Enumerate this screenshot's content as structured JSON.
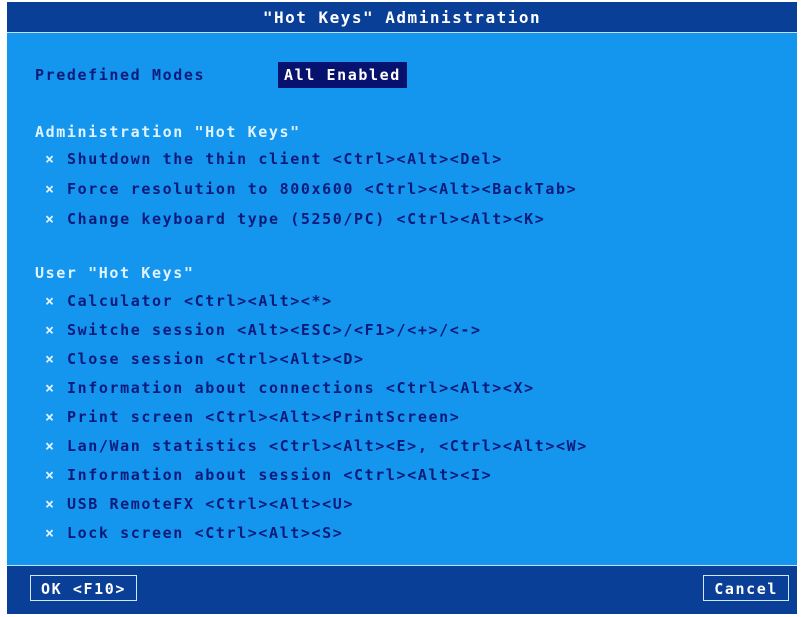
{
  "window": {
    "title": "\"Hot Keys\" Administration"
  },
  "modes": {
    "label": "Predefined Modes",
    "value": "All Enabled"
  },
  "admin": {
    "heading": "Administration \"Hot Keys\"",
    "items": [
      {
        "mark": "×",
        "label": "Shutdown the thin client <Ctrl><Alt><Del>"
      },
      {
        "mark": "×",
        "label": "Force resolution to 800x600 <Ctrl><Alt><BackTab>"
      },
      {
        "mark": "×",
        "label": "Change keyboard type (5250/PC) <Ctrl><Alt><K>"
      }
    ]
  },
  "user": {
    "heading": "User \"Hot Keys\"",
    "items": [
      {
        "mark": "×",
        "label": "Calculator <Ctrl><Alt><*>"
      },
      {
        "mark": "×",
        "label": "Switche session  <Alt><ESC>/<F1>/<+>/<->"
      },
      {
        "mark": "×",
        "label": "Close session <Ctrl><Alt><D>"
      },
      {
        "mark": "×",
        "label": "Information about connections <Ctrl><Alt><X>"
      },
      {
        "mark": "×",
        "label": "Print screen <Ctrl><Alt><PrintScreen>"
      },
      {
        "mark": "×",
        "label": "Lan/Wan statistics <Ctrl><Alt><E>, <Ctrl><Alt><W>"
      },
      {
        "mark": "×",
        "label": "Information about session <Ctrl><Alt><I>"
      },
      {
        "mark": "×",
        "label": "USB RemoteFX <Ctrl><Alt><U>"
      },
      {
        "mark": "×",
        "label": "Lock screen <Ctrl><Alt><S>"
      }
    ]
  },
  "footer": {
    "ok_label": "OK <F10>",
    "cancel_label": "Cancel"
  }
}
